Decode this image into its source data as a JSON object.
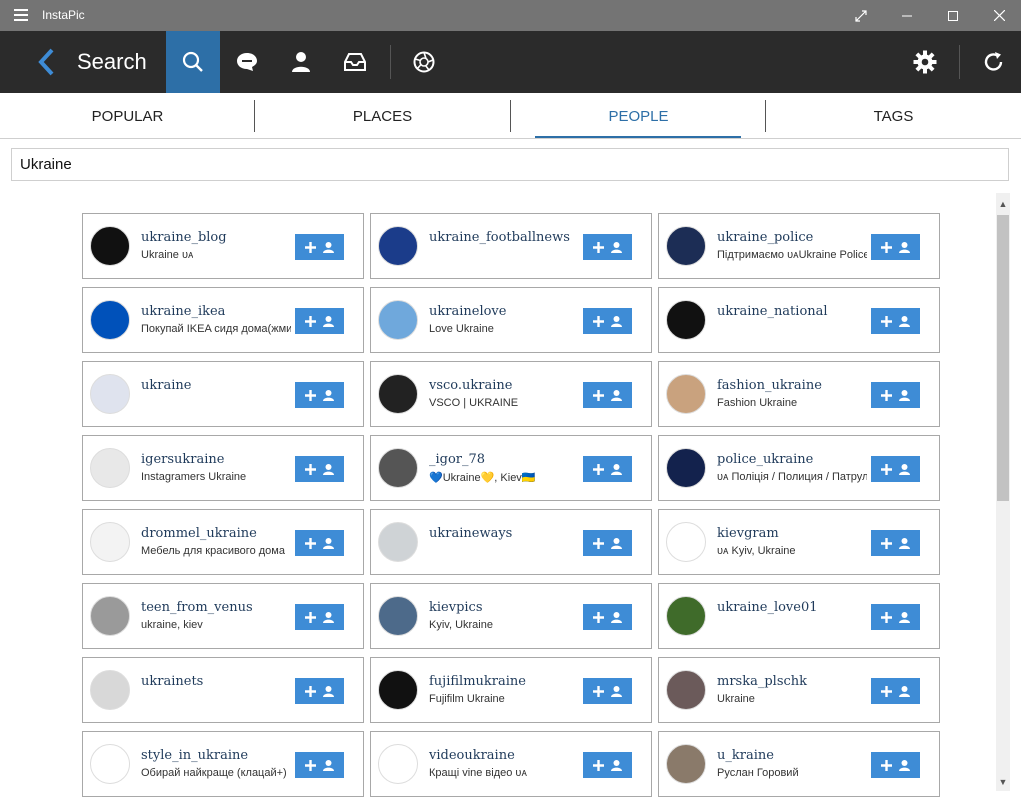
{
  "app": {
    "title": "InstaPic"
  },
  "toolbar": {
    "page_title": "Search",
    "buttons": [
      "search-icon",
      "chat-icon",
      "person-icon",
      "inbox-icon",
      "aperture-icon",
      "gear-icon",
      "refresh-icon"
    ],
    "active": "search-icon",
    "accent_color": "#2d6fa7"
  },
  "tabs": [
    {
      "label": "POPULAR"
    },
    {
      "label": "PLACES"
    },
    {
      "label": "PEOPLE"
    },
    {
      "label": "TAGS"
    }
  ],
  "active_tab": "PEOPLE",
  "search": {
    "value": "Ukraine"
  },
  "follow_button_color": "#3e8cd6",
  "users": [
    {
      "name": "ukraine_blog",
      "desc": "Ukraine ᴜᴀ",
      "avatar_color": "#111"
    },
    {
      "name": "ukraine_footballnews",
      "desc": "",
      "avatar_color": "#1b3c8a"
    },
    {
      "name": "ukraine_police",
      "desc": "Підтримаємо ᴜᴀUkraine Police",
      "avatar_color": "#1c2d55"
    },
    {
      "name": "ukraine_ikea",
      "desc": "Покупай IKEA сидя дома(жмите",
      "avatar_color": "#0051ba"
    },
    {
      "name": "ukrainelove",
      "desc": "Love Ukraine",
      "avatar_color": "#6fa8dc"
    },
    {
      "name": "ukraine_national",
      "desc": "",
      "avatar_color": "#111"
    },
    {
      "name": "ukraine",
      "desc": "",
      "avatar_color": "#dfe3ee"
    },
    {
      "name": "vsco.ukraine",
      "desc": "VSCO | UKRAINE",
      "avatar_color": "#222"
    },
    {
      "name": "fashion_ukraine",
      "desc": "Fashion Ukraine",
      "avatar_color": "#c9a27e"
    },
    {
      "name": "igersukraine",
      "desc": "Instagramers Ukraine",
      "avatar_color": "#e8e8e8"
    },
    {
      "name": "_igor_78",
      "desc": "💙Ukraine💛, Kiev🇺🇦",
      "avatar_color": "#555"
    },
    {
      "name": "police_ukraine",
      "desc": "ᴜᴀ Поліція / Полиция / Патрул",
      "avatar_color": "#13224d"
    },
    {
      "name": "drommel_ukraine",
      "desc": "Мебель для красивого дома",
      "avatar_color": "#f3f3f3"
    },
    {
      "name": "ukraineways",
      "desc": "",
      "avatar_color": "#cfd3d6"
    },
    {
      "name": "kievgram",
      "desc": "ᴜᴀ Kyiv, Ukraine",
      "avatar_color": "#fff"
    },
    {
      "name": "teen_from_venus",
      "desc": "ukraine, kiev",
      "avatar_color": "#9a9a9a"
    },
    {
      "name": "kievpics",
      "desc": "Kyiv, Ukraine",
      "avatar_color": "#4d6a8a"
    },
    {
      "name": "ukraine_love01",
      "desc": "",
      "avatar_color": "#3f6b2a"
    },
    {
      "name": "ukrainets",
      "desc": "",
      "avatar_color": "#d8d8d8"
    },
    {
      "name": "fujifilmukraine",
      "desc": "Fujifilm Ukraine",
      "avatar_color": "#111"
    },
    {
      "name": "mrska_plschk",
      "desc": "Ukraine",
      "avatar_color": "#6b5a5a"
    },
    {
      "name": "style_in_ukraine",
      "desc": "Обирай найкраще (клацай+)",
      "avatar_color": "#fff"
    },
    {
      "name": "videoukraine",
      "desc": "Кращі vine відео ᴜᴀ",
      "avatar_color": "#fff"
    },
    {
      "name": "u_kraine",
      "desc": "Руслан Горовий",
      "avatar_color": "#8a7a6a"
    }
  ]
}
